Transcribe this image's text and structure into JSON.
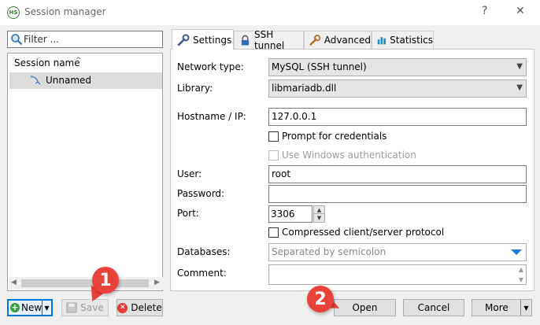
{
  "window": {
    "title": "Session manager",
    "help": "?",
    "close": "✕"
  },
  "filter": {
    "placeholder": "Filter ..."
  },
  "tree": {
    "header": "Session name",
    "sort_arrow": "^",
    "items": [
      {
        "label": "Unnamed"
      }
    ]
  },
  "left_buttons": {
    "new": "New",
    "save": "Save",
    "delete": "Delete"
  },
  "tabs": [
    {
      "label": "Settings",
      "icon": "wrench-icon",
      "active": true
    },
    {
      "label": "SSH tunnel",
      "icon": "lock-icon"
    },
    {
      "label": "Advanced",
      "icon": "wrench-icon"
    },
    {
      "label": "Statistics",
      "icon": "bar-chart-icon"
    }
  ],
  "settings": {
    "network_type_label": "Network type:",
    "network_type_value": "MySQL (SSH tunnel)",
    "library_label": "Library:",
    "library_value": "libmariadb.dll",
    "hostname_label": "Hostname / IP:",
    "hostname_value": "127.0.0.1",
    "prompt_credentials": "Prompt for credentials",
    "windows_auth": "Use Windows authentication",
    "user_label": "User:",
    "user_value": "root",
    "password_label": "Password:",
    "password_value": "",
    "port_label": "Port:",
    "port_value": "3306",
    "compressed": "Compressed client/server protocol",
    "databases_label": "Databases:",
    "databases_placeholder": "Separated by semicolon",
    "comment_label": "Comment:"
  },
  "bottom_buttons": {
    "open": "Open",
    "cancel": "Cancel",
    "more": "More"
  },
  "callouts": [
    "1",
    "2"
  ],
  "colors": {
    "callout": "#e8423a",
    "focus": "#0078d7",
    "combo_arrow": "#1a7ad7"
  }
}
